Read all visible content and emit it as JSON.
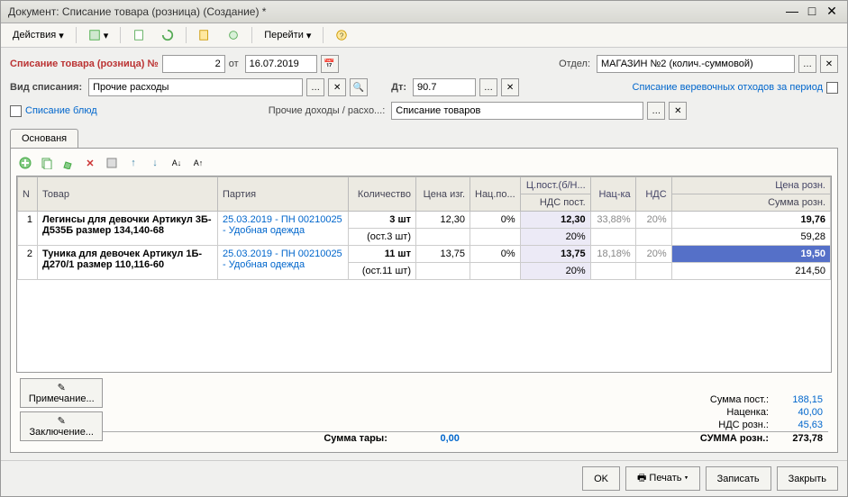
{
  "title": "Документ: Списание товара (розница) (Создание) *",
  "toolbar": {
    "actions": "Действия",
    "go": "Перейти"
  },
  "header": {
    "doc_title": "Списание товара (розница) №",
    "num": "2",
    "from": "от",
    "date": "16.07.2019",
    "dept_lbl": "Отдел:",
    "dept": "МАГАЗИН №2 (колич.-суммовой)",
    "kind_lbl": "Вид списания:",
    "kind": "Прочие расходы",
    "dt_lbl": "Дт:",
    "dt": "90.7",
    "rope": "Списание веревочных отходов за период",
    "dish": "Списание блюд",
    "other_lbl": "Прочие доходы / расхо...:",
    "other": "Списание товаров"
  },
  "tab": "Основаня",
  "cols": {
    "n": "N",
    "tovar": "Товар",
    "party": "Партия",
    "qty": "Количество",
    "price": "Цена изг.",
    "nadp": "Нац.по...",
    "cpost": "Ц.пост.(б/Н...",
    "nacka": "Нац-ка",
    "nds": "НДС",
    "rozn": "Цена розн.",
    "ndspost": "НДС пост.",
    "srozn": "Сумма розн."
  },
  "rows": [
    {
      "n": "1",
      "tovar": "Легинсы для девочки  Артикул 3Б-Д535Б размер 134,140-68",
      "party": "25.03.2019 - ПН 00210025 - Удобная одежда",
      "qty": "3 шт",
      "ost": "(ост.3 шт)",
      "price": "12,30",
      "nadp": "0%",
      "cpost": "12,30",
      "nacka": "33,88%",
      "nds": "20%",
      "rozn": "19,76",
      "nds2": "20%",
      "srozn": "59,28"
    },
    {
      "n": "2",
      "tovar": "Туника для девочек Артикул 1Б-Д270/1 размер 110,116-60",
      "party": "25.03.2019 - ПН 00210025 - Удобная одежда",
      "qty": "11 шт",
      "ost": "(ост.11 шт)",
      "price": "13,75",
      "nadp": "0%",
      "cpost": "13,75",
      "nacka": "18,18%",
      "nds": "20%",
      "rozn": "19,50",
      "nds2": "20%",
      "srozn": "214,50"
    }
  ],
  "footer": {
    "note": "Примечание...",
    "concl": "Заключение...",
    "tara_lbl": "Сумма тары:",
    "tara": "0,00",
    "spost_lbl": "Сумма пост.:",
    "spost": "188,15",
    "nac_lbl": "Наценка:",
    "nac": "40,00",
    "ndsr_lbl": "НДС розн.:",
    "ndsr": "45,63",
    "total_lbl": "СУММА розн.:",
    "total": "273,78"
  },
  "buttons": {
    "ok": "OK",
    "print": "Печать",
    "save": "Записать",
    "close": "Закрыть"
  }
}
